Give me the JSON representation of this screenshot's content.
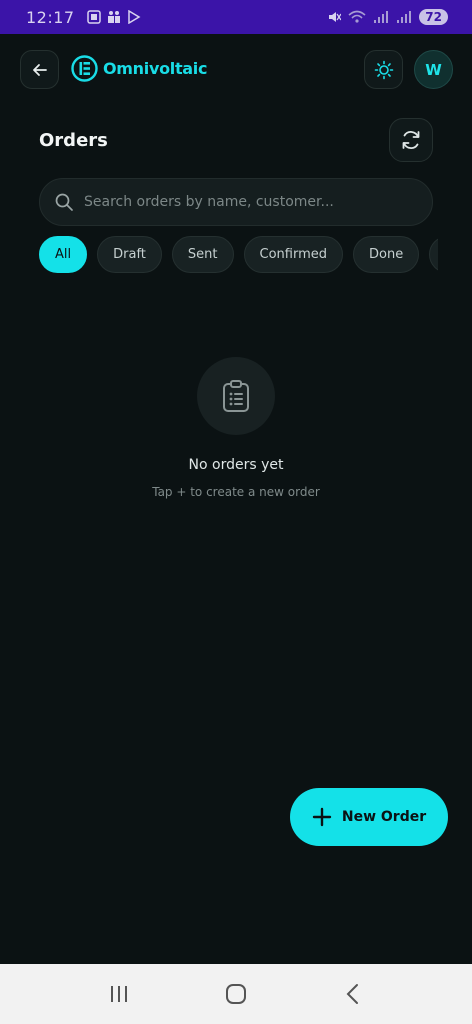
{
  "status_bar": {
    "time": "12:17",
    "battery": "72",
    "left_icons": [
      "gallery-icon",
      "teams-icon",
      "play-store-icon"
    ],
    "right_icons": [
      "mute-icon",
      "wifi-icon",
      "signal-icon",
      "signal-icon"
    ]
  },
  "app": {
    "logo_text": "Omnivoltaic",
    "avatar_initial": "W",
    "accent_color": "#14e1e8"
  },
  "orders": {
    "title": "Orders",
    "search_placeholder": "Search orders by name, customer...",
    "filters": [
      {
        "label": "All",
        "active": true
      },
      {
        "label": "Draft",
        "active": false
      },
      {
        "label": "Sent",
        "active": false
      },
      {
        "label": "Confirmed",
        "active": false
      },
      {
        "label": "Done",
        "active": false
      },
      {
        "label": "C",
        "active": false
      }
    ],
    "empty_title": "No orders yet",
    "empty_subtitle": "Tap + to create a new order",
    "fab_label": "New Order"
  },
  "nav_bar": {
    "icons": [
      "recents-icon",
      "home-icon",
      "back-icon"
    ]
  }
}
